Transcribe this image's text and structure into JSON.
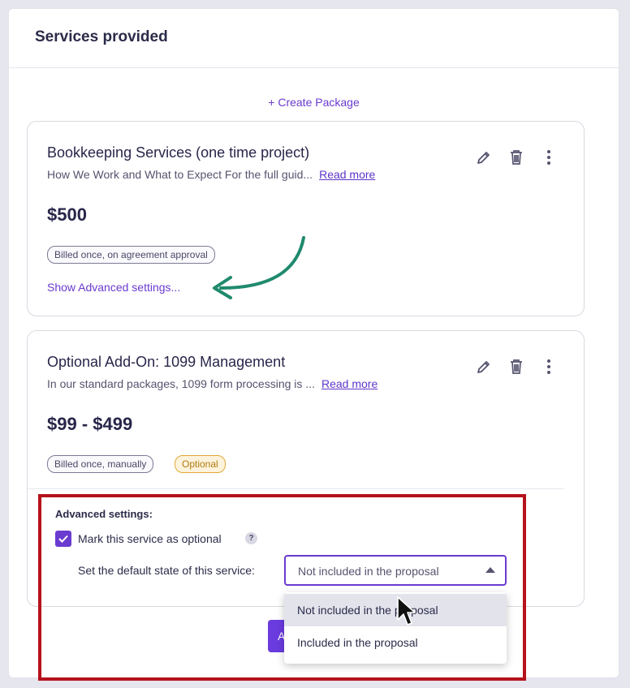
{
  "panel": {
    "title": "Services provided",
    "create_package": "+ Create Package"
  },
  "cards": [
    {
      "title": "Bookkeeping Services (one time project)",
      "description": "How We Work and What to Expect For the full guid...",
      "read_more": "Read more",
      "price": "$500",
      "badges": [
        "Billed once, on agreement approval"
      ],
      "advanced_link": "Show Advanced settings..."
    },
    {
      "title": "Optional Add-On: 1099 Management",
      "description": "In our standard packages, 1099 form processing is ...",
      "read_more": "Read more",
      "price": "$99 - $499",
      "badges": [
        "Billed once, manually",
        "Optional"
      ]
    }
  ],
  "advanced": {
    "label": "Advanced settings:",
    "optional_checkbox_label": "Mark this service as optional",
    "optional_checked": true,
    "help": "?",
    "default_state_label": "Set the default state of this service:",
    "select_value": "Not included in the proposal",
    "options": [
      "Not included in the proposal",
      "Included in the proposal"
    ],
    "hovered_option_index": 0
  },
  "primary_button": {
    "label": "A"
  },
  "icons": [
    "pencil-icon",
    "trash-icon",
    "more-vertical-icon",
    "checkmark-icon",
    "caret-up-icon",
    "curved-arrow-annotation",
    "mouse-cursor"
  ],
  "colors": {
    "accent": "#6a3bcf",
    "highlight_box": "#b5121b",
    "arrow": "#1f8a6d",
    "optional_badge": "#e0a838"
  }
}
